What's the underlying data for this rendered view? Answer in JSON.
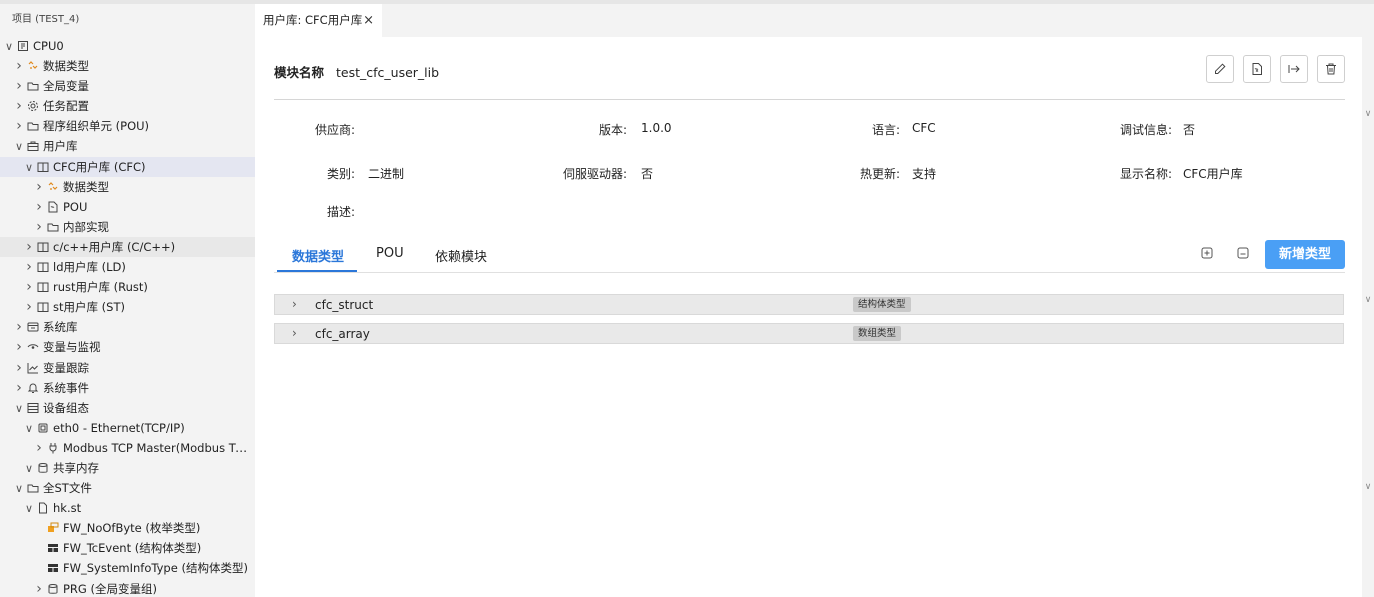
{
  "sidebar": {
    "title": "项目 (TEST_4)",
    "items": [
      {
        "label": "CPU0",
        "depth": 0,
        "chevron": "down",
        "icon": "cpu-icon"
      },
      {
        "label": "数据类型",
        "depth": 1,
        "chevron": "right",
        "icon": "datatype-icon"
      },
      {
        "label": "全局变量",
        "depth": 1,
        "chevron": "right",
        "icon": "folder-icon"
      },
      {
        "label": "任务配置",
        "depth": 1,
        "chevron": "right",
        "icon": "gear-icon"
      },
      {
        "label": "程序组织单元 (POU)",
        "depth": 1,
        "chevron": "right",
        "icon": "folder-icon"
      },
      {
        "label": "用户库",
        "depth": 1,
        "chevron": "down",
        "icon": "toolbox-icon"
      },
      {
        "label": "CFC用户库 (CFC)",
        "depth": 2,
        "chevron": "down",
        "icon": "book-icon",
        "state": "selected"
      },
      {
        "label": "数据类型",
        "depth": 3,
        "chevron": "right",
        "icon": "datatype-icon"
      },
      {
        "label": "POU",
        "depth": 3,
        "chevron": "right",
        "icon": "pou-icon"
      },
      {
        "label": "内部实现",
        "depth": 3,
        "chevron": "right",
        "icon": "folder-icon"
      },
      {
        "label": "c/c++用户库 (C/C++)",
        "depth": 2,
        "chevron": "right",
        "icon": "book-icon",
        "state": "hover"
      },
      {
        "label": "ld用户库 (LD)",
        "depth": 2,
        "chevron": "right",
        "icon": "book-icon"
      },
      {
        "label": "rust用户库 (Rust)",
        "depth": 2,
        "chevron": "right",
        "icon": "book-icon"
      },
      {
        "label": "st用户库 (ST)",
        "depth": 2,
        "chevron": "right",
        "icon": "book-icon"
      },
      {
        "label": "系统库",
        "depth": 1,
        "chevron": "right",
        "icon": "library-icon"
      },
      {
        "label": "变量与监视",
        "depth": 1,
        "chevron": "right",
        "icon": "eye-icon"
      },
      {
        "label": "变量跟踪",
        "depth": 1,
        "chevron": "right",
        "icon": "trend-icon"
      },
      {
        "label": "系统事件",
        "depth": 1,
        "chevron": "right",
        "icon": "bell-icon"
      },
      {
        "label": "设备组态",
        "depth": 1,
        "chevron": "down",
        "icon": "device-icon"
      },
      {
        "label": "eth0 - Ethernet(TCP/IP)",
        "depth": 2,
        "chevron": "down",
        "icon": "ethernet-icon"
      },
      {
        "label": "Modbus TCP Master(Modbus TCP...",
        "depth": 3,
        "chevron": "right",
        "icon": "plug-icon"
      },
      {
        "label": "共享内存",
        "depth": 2,
        "chevron": "down",
        "icon": "database-icon"
      },
      {
        "label": "全ST文件",
        "depth": 1,
        "chevron": "down",
        "icon": "folder-icon"
      },
      {
        "label": "hk.st",
        "depth": 2,
        "chevron": "down",
        "icon": "file-icon"
      },
      {
        "label": "FW_NoOfByte (枚举类型)",
        "depth": 3,
        "chevron": "none",
        "icon": "enum-icon"
      },
      {
        "label": "FW_TcEvent (结构体类型)",
        "depth": 3,
        "chevron": "none",
        "icon": "struct-icon"
      },
      {
        "label": "FW_SystemInfoType (结构体类型)",
        "depth": 3,
        "chevron": "none",
        "icon": "struct-icon"
      },
      {
        "label": "PRG (全局变量组)",
        "depth": 3,
        "chevron": "right",
        "icon": "database-icon"
      }
    ]
  },
  "tab": {
    "label": "用户库: CFC用户库",
    "close": "×"
  },
  "module": {
    "name_label": "模块名称",
    "name_value": "test_cfc_user_lib"
  },
  "toolbar": {
    "icons": [
      "edit-icon",
      "pou-icon",
      "export-icon",
      "delete-icon"
    ]
  },
  "properties": {
    "vendor": {
      "label": "供应商:",
      "value": ""
    },
    "version": {
      "label": "版本:",
      "value": "1.0.0"
    },
    "language": {
      "label": "语言:",
      "value": "CFC"
    },
    "debug": {
      "label": "调试信息:",
      "value": "否"
    },
    "category": {
      "label": "类别:",
      "value": "二进制"
    },
    "servo": {
      "label": "伺服驱动器:",
      "value": "否"
    },
    "hotupdate": {
      "label": "热更新:",
      "value": "支持"
    },
    "display": {
      "label": "显示名称:",
      "value": "CFC用户库"
    },
    "desc": {
      "label": "描述:",
      "value": ""
    }
  },
  "subtabs": {
    "datatypes": "数据类型",
    "pou": "POU",
    "deps": "依赖模块",
    "active": "数据类型"
  },
  "add_button": "新增类型",
  "datatypes": [
    {
      "name": "cfc_struct",
      "kind": "结构体类型"
    },
    {
      "name": "cfc_array",
      "kind": "数组类型"
    }
  ],
  "colors": {
    "accent": "#2b77d9",
    "button": "#4a9ff5",
    "selected": "#e4e6f1"
  }
}
